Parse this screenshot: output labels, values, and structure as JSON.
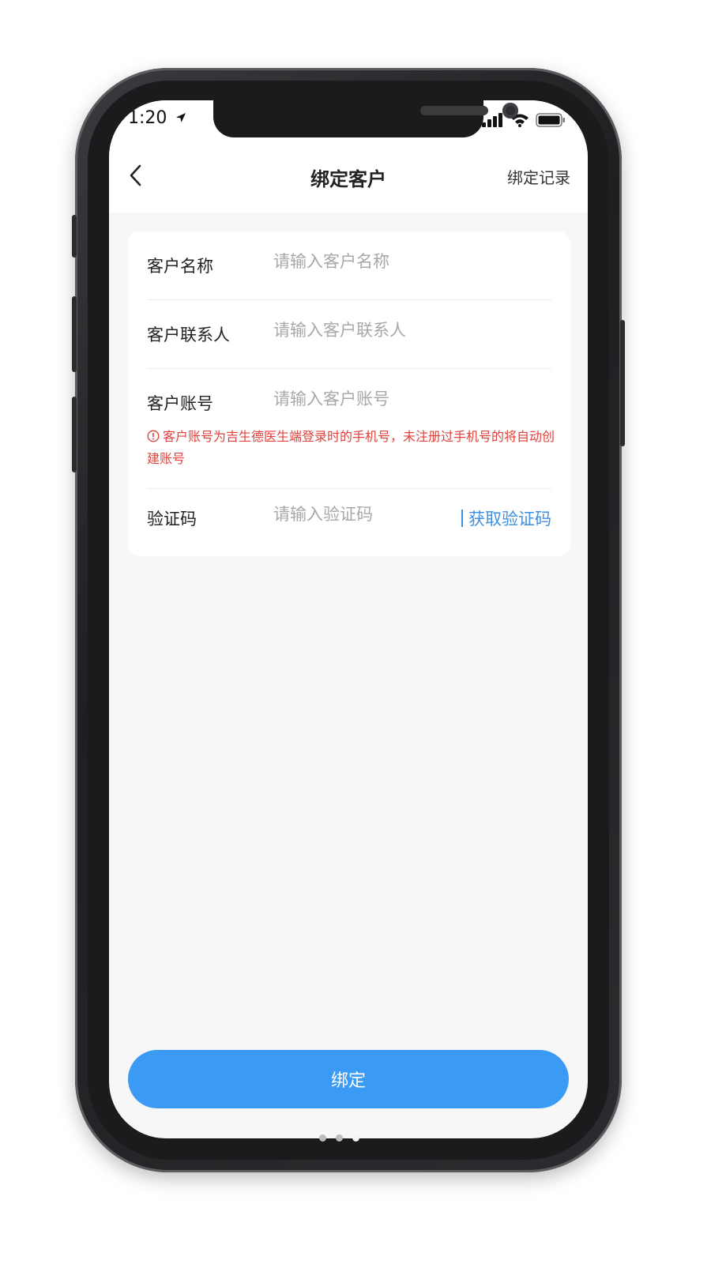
{
  "status_bar": {
    "time": "1:20"
  },
  "nav": {
    "title": "绑定客户",
    "right_link": "绑定记录"
  },
  "form": {
    "customer_name": {
      "label": "客户名称",
      "placeholder": "请输入客户名称",
      "value": ""
    },
    "customer_contact": {
      "label": "客户联系人",
      "placeholder": "请输入客户联系人",
      "value": ""
    },
    "customer_account": {
      "label": "客户账号",
      "placeholder": "请输入客户账号",
      "value": "",
      "warning": "客户账号为吉生德医生端登录时的手机号，未注册过手机号的将自动创建账号"
    },
    "verification_code": {
      "label": "验证码",
      "placeholder": "请输入验证码",
      "value": "",
      "get_code_label": "获取验证码"
    }
  },
  "bind_button": {
    "label": "绑定"
  },
  "colors": {
    "accent": "#3a9af4",
    "link": "#3e8fe0",
    "warning": "#e0413c",
    "background": "#f7f7f7"
  }
}
